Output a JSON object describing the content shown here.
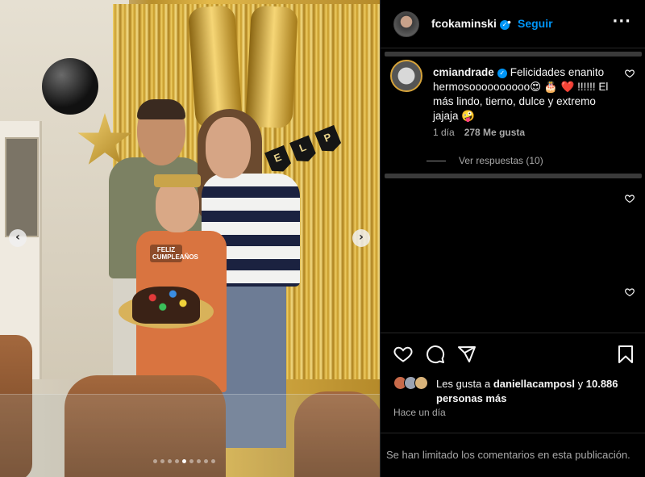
{
  "post": {
    "topper_text": "FELIZ CUMPLEAÑOS",
    "banner_letters": [
      "E",
      "L",
      "P"
    ],
    "carousel": {
      "total_slides": 9,
      "active_index": 4
    },
    "prev_glyph": "‹",
    "next_glyph": "›"
  },
  "header": {
    "username": "fcokaminski",
    "verified_glyph": "✓",
    "separator": "•",
    "follow_label": "Seguir",
    "more_glyph": "···"
  },
  "comment": {
    "username": "cmiandrade",
    "text_part1": "Felicidades enanito hermosoooooooooo",
    "emojis_1": "😍 🎂 ❤️",
    "text_part2": "!!!!!! El más lindo, tierno, dulce y extremo jajaja",
    "emoji_2": "🤪",
    "age": "1 día",
    "likes": "278 Me gusta",
    "view_replies": "Ver respuestas (10)"
  },
  "likes": {
    "prefix": "Les gusta a",
    "user": "daniellacamposl",
    "connector": "y",
    "count": "10.886 personas más"
  },
  "timestamp": "Hace un día",
  "comments_limited": "Se han limitado los comentarios en esta publicación.",
  "colors": {
    "accent": "#0095f6",
    "background": "#000000",
    "text": "#f5f5f5",
    "secondary_text": "#a8a8a8",
    "heart": "#ff3040"
  },
  "icons": [
    "heart-icon",
    "comment-icon",
    "share-icon",
    "bookmark-icon",
    "verified-badge-icon",
    "more-options-icon",
    "chevron-left-icon",
    "chevron-right-icon"
  ]
}
